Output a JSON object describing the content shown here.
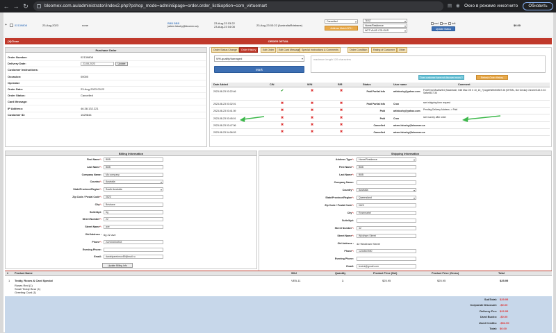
{
  "browser": {
    "url": "bloomex.com.au/administrator/index2.php?pshop_mode=admin&page=order.order_list&option=com_virtuemart",
    "incognito_label": "Окно в режиме инкогнито",
    "update_label": "Обновить"
  },
  "list_row": {
    "order_id": "02139808",
    "date": "23-Aug-2023",
    "col3": "none",
    "customer": "BBB BBB",
    "email": "(artem.lstuchy@bloomex.ca)",
    "created": "23-Aug-23 03:22",
    "modified": "23-Aug-23 04:08",
    "delivery": "23-Aug-23 03:22 (Australia/Brisbane)",
    "status_select": "Cancelled",
    "address_type_select": "Home/Residence",
    "test_select": "TEST",
    "valid_select": "NOT VALID COLOUR",
    "assign_btn": "Address Match BTH",
    "check_labels": [
      "red",
      "sm",
      "tcft"
    ],
    "update_btn": "Update Status",
    "amount": "$0.00"
  },
  "order_detail": {
    "bar_left": "(X)Close",
    "bar_title": "ORDER DETAIL",
    "po_title": "Purchase Order",
    "fields": [
      {
        "label": "Order Number:",
        "value": "02139808"
      },
      {
        "label": "Delivery Date:",
        "value": "23-08-2023"
      },
      {
        "label": "Customer Instructions:",
        "value": ""
      },
      {
        "label": "Occasion:",
        "value": "00000"
      },
      {
        "label": "Operator:",
        "value": ""
      },
      {
        "label": "Order Date:",
        "value": "23-Aug-2023 03:22"
      },
      {
        "label": "Order Status:",
        "value": "Cancelled"
      },
      {
        "label": "Card Message:",
        "value": ""
      },
      {
        "label": "IP Address:",
        "value": "46.38.132.221"
      },
      {
        "label": "Customer ID:",
        "value": "1529844"
      }
    ],
    "update_label": "Update"
  },
  "tabs": [
    "Order Status Change",
    "Order History",
    "Edit Order",
    "Edit Card Message",
    "Special Instructions & Comments",
    "Order Condition",
    "Rating of Customer",
    "Other"
  ],
  "history": {
    "reason_select": "WH-quality/damaged",
    "comment_placeholder": "maximum length 120 characters",
    "mark_label": "Mark",
    "did_customer_btn": "Does customer have not discover errors ?",
    "refresh_btn": "Refresh Order History",
    "headers": [
      "Date Added",
      "C/N",
      "W/N",
      "R/R",
      "Status",
      "User name",
      "Comment"
    ],
    "rows": [
      {
        "date": "2023-08-23 03:22:46",
        "cn": "ok",
        "status": "Paid Partial Info",
        "user": "artlstuchy@yahoo.com",
        "comment": "FroM End Mozilla/5.0 (Macintosh; Intel Mac OS X 10_15_7) AppleWebKit/537.36 (KHTML, like Gecko) Chrome/115.0.0.0 Safari/537.36"
      },
      {
        "date": "2023-08-23 03:32:01",
        "cn": "x",
        "status": "Paid Partial Info",
        "user": "Cron",
        "comment": "sent shipping form request"
      },
      {
        "date": "2023-08-23 03:41:39",
        "cn": "x",
        "status": "Paid",
        "user": "artlstuchy@yahoo.com",
        "comment": "Pending Delivery Address -> Paid"
      },
      {
        "date": "2023-08-23 03:45:01",
        "cn": "x",
        "status": "Paid",
        "user": "Cron",
        "comment": "sent survey after order"
      },
      {
        "date": "2023-08-23 03:47:36",
        "cn": "x",
        "status": "Cancelled",
        "user": "artem.lstuchy@bloomex.ca",
        "comment": ""
      },
      {
        "date": "2023-08-23 04:06:03",
        "cn": "x",
        "status": "Cancelled",
        "user": "artem.lstuchy@bloomex.ca",
        "comment": ""
      }
    ]
  },
  "billing": {
    "title": "Billing Information",
    "fields": [
      {
        "label": "First Name",
        "req": true,
        "value": "BBB",
        "type": "input"
      },
      {
        "label": "Last Name",
        "req": true,
        "value": "BBB",
        "type": "input"
      },
      {
        "label": "Company Name:",
        "req": false,
        "value": "My company",
        "type": "input"
      },
      {
        "label": "Country",
        "req": true,
        "value": "Australia",
        "type": "select"
      },
      {
        "label": "State/Province/Region",
        "req": true,
        "value": "South Australia",
        "type": "select"
      },
      {
        "label": "Zip Code / Postal Code",
        "req": true,
        "value": "0623",
        "type": "input"
      },
      {
        "label": "City",
        "req": true,
        "value": "Brisbane",
        "type": "input"
      },
      {
        "label": "Suite/Apt:",
        "req": false,
        "value": "6g",
        "type": "input"
      },
      {
        "label": "Street Number",
        "req": true,
        "value": "22",
        "type": "input"
      },
      {
        "label": "Street Name",
        "req": true,
        "value": "ave",
        "type": "input"
      },
      {
        "label": "Old Address :",
        "req": false,
        "value": "6g 22 ave",
        "type": "text"
      },
      {
        "label": "Phone",
        "req": true,
        "value": "222333333333",
        "type": "input"
      },
      {
        "label": "Evening Phone:",
        "req": false,
        "value": "",
        "type": "input"
      },
      {
        "label": "Email:",
        "req": false,
        "value": "danielparekmov89@mail.ru",
        "type": "input"
      }
    ],
    "button": "Update Billing Info"
  },
  "shipping": {
    "title": "Shipping Information",
    "fields": [
      {
        "label": "Address Type",
        "req": true,
        "value": "Home/Residence",
        "type": "select"
      },
      {
        "label": "First Name",
        "req": true,
        "value": "BBB",
        "type": "input"
      },
      {
        "label": "Last Name",
        "req": true,
        "value": "BBB",
        "type": "input"
      },
      {
        "label": "Company Name:",
        "req": false,
        "value": "",
        "type": "input"
      },
      {
        "label": "Country",
        "req": true,
        "value": "Australia",
        "type": "select"
      },
      {
        "label": "State/Province/Region",
        "req": true,
        "value": "Queensland",
        "type": "select"
      },
      {
        "label": "Zip Code / Postal Code",
        "req": true,
        "value": "0623",
        "type": "input"
      },
      {
        "label": "City",
        "req": true,
        "value": "Rosemartel",
        "type": "input"
      },
      {
        "label": "Suite/Apt:",
        "req": false,
        "value": "",
        "type": "input"
      },
      {
        "label": "Street Number",
        "req": true,
        "value": "42",
        "type": "input"
      },
      {
        "label": "Street Name",
        "req": true,
        "value": "Wickham Street",
        "type": "input"
      },
      {
        "label": "Old Address :",
        "req": false,
        "value": "42 Wickham Street",
        "type": "text"
      },
      {
        "label": "Phone",
        "req": true,
        "value": "1234567890",
        "type": "input"
      },
      {
        "label": "Evening Phone:",
        "req": false,
        "value": "",
        "type": "input"
      },
      {
        "label": "Email:",
        "req": false,
        "value": "testmt@gmail.com",
        "type": "input"
      }
    ],
    "button": "Update Shipping Info"
  },
  "products": {
    "headers": [
      "#",
      "Product Name",
      "SKU",
      "Quantity",
      "Product Price (Net)",
      "Product Price (Gross)",
      "Total"
    ],
    "rows": [
      {
        "num": "1",
        "name": "Teddy, Roses & Card Special",
        "sku": "VEB-11",
        "qty": "1",
        "net": "$25.95",
        "gross": "$25.95",
        "total": "$25.95",
        "subitems": [
          "Roses Red (1)",
          "Small Teddy Bear (1)",
          "Greeting Card (1)"
        ]
      }
    ],
    "totals": [
      {
        "label": "SubTotal:",
        "value": "$29.95"
      },
      {
        "label": "Corporate Discount:",
        "value": "-$0.00"
      },
      {
        "label": "Delivery Fee:",
        "value": "$22.95"
      },
      {
        "label": "Used Bucks:",
        "value": "-$0.00"
      },
      {
        "label": "Used Credits:",
        "value": "-$52.90"
      },
      {
        "label": "Total:",
        "value": "$0.00"
      }
    ]
  }
}
